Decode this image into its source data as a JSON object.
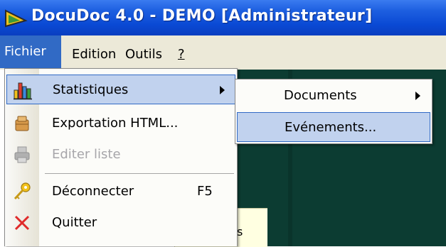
{
  "window": {
    "title": "DocuDoc 4.0 - DEMO [Administrateur]",
    "app_icon": "docudoc-logo-icon"
  },
  "menubar": {
    "items": [
      {
        "label": "Fichier",
        "active": true
      },
      {
        "label": "Edition",
        "active": false
      },
      {
        "label": "Outils",
        "active": false
      },
      {
        "label": "?",
        "active": false
      }
    ]
  },
  "fichier_menu": {
    "items": [
      {
        "label": "Statistiques",
        "icon": "chart-bars-icon",
        "has_submenu": true,
        "highlighted": true,
        "enabled": true
      },
      {
        "label": "Exportation HTML...",
        "icon": "package-export-icon",
        "enabled": true
      },
      {
        "label": "Editer liste",
        "icon": "print-list-icon",
        "enabled": false
      },
      {
        "label": "Déconnecter",
        "icon": "key-icon",
        "shortcut": "F5",
        "enabled": true
      },
      {
        "label": "Quitter",
        "icon": "red-x-close-icon",
        "enabled": true
      }
    ]
  },
  "statistiques_submenu": {
    "items": [
      {
        "label": "Documents",
        "has_submenu": true,
        "highlighted": false
      },
      {
        "label": "Evénements...",
        "has_submenu": false,
        "highlighted": true
      }
    ]
  },
  "background": {
    "tooltip_fragment": "s"
  },
  "colors": {
    "titlebar": "#0a49d4",
    "menu_highlight": "#316ac5",
    "menu_hover_bg": "#c1d2ee",
    "dark_panel": "#0c3c32"
  }
}
